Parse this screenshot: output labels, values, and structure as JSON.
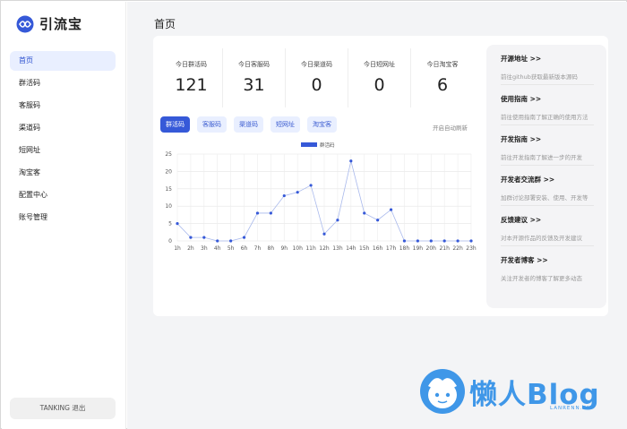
{
  "app": {
    "title": "引流宝"
  },
  "sidebar": {
    "items": [
      {
        "label": "首页",
        "active": true
      },
      {
        "label": "群活码"
      },
      {
        "label": "客服码"
      },
      {
        "label": "渠道码"
      },
      {
        "label": "短网址"
      },
      {
        "label": "淘宝客"
      },
      {
        "label": "配置中心"
      },
      {
        "label": "账号管理"
      }
    ],
    "user": "TANKING  退出"
  },
  "page": {
    "title": "首页"
  },
  "stats": [
    {
      "label": "今日群活码",
      "value": "121"
    },
    {
      "label": "今日客服码",
      "value": "31"
    },
    {
      "label": "今日渠道码",
      "value": "0"
    },
    {
      "label": "今日短网址",
      "value": "0"
    },
    {
      "label": "今日淘宝客",
      "value": "6"
    }
  ],
  "tabs": [
    {
      "label": "群活码",
      "active": true
    },
    {
      "label": "客服码"
    },
    {
      "label": "渠道码"
    },
    {
      "label": "短网址"
    },
    {
      "label": "淘宝客"
    }
  ],
  "auto_refresh": "开启自动刷新",
  "chart_data": {
    "type": "line",
    "categories": [
      "1h",
      "2h",
      "3h",
      "4h",
      "5h",
      "6h",
      "7h",
      "8h",
      "9h",
      "10h",
      "11h",
      "12h",
      "13h",
      "14h",
      "15h",
      "16h",
      "17h",
      "18h",
      "19h",
      "20h",
      "21h",
      "22h",
      "23h"
    ],
    "series": [
      {
        "name": "群活码",
        "values": [
          5,
          1,
          1,
          0,
          0,
          1,
          8,
          8,
          13,
          14,
          16,
          2,
          6,
          23,
          8,
          6,
          9,
          0,
          0,
          0,
          0,
          0,
          0
        ]
      }
    ],
    "ylim": [
      0,
      25
    ],
    "yticks": [
      0,
      5,
      10,
      15,
      20,
      25
    ],
    "grid": true,
    "legend": "top-center",
    "color": "#3659d8"
  },
  "panel": [
    {
      "title": "开源地址 >>",
      "desc": "前往github获取最新版本源码"
    },
    {
      "title": "使用指南 >>",
      "desc": "前往使用指南了解正确的使用方法"
    },
    {
      "title": "开发指南 >>",
      "desc": "前往开发指南了解进一步的开发"
    },
    {
      "title": "开发者交流群 >>",
      "desc": "加群讨论部署安装、使用、开发等"
    },
    {
      "title": "反馈建议 >>",
      "desc": "对本开源作品的反馈及开发建议"
    },
    {
      "title": "开发者博客 >>",
      "desc": "关注开发者的博客了解更多动态"
    }
  ],
  "watermark": {
    "text": "懒人Blog",
    "sub": "LANRENN.CN"
  }
}
